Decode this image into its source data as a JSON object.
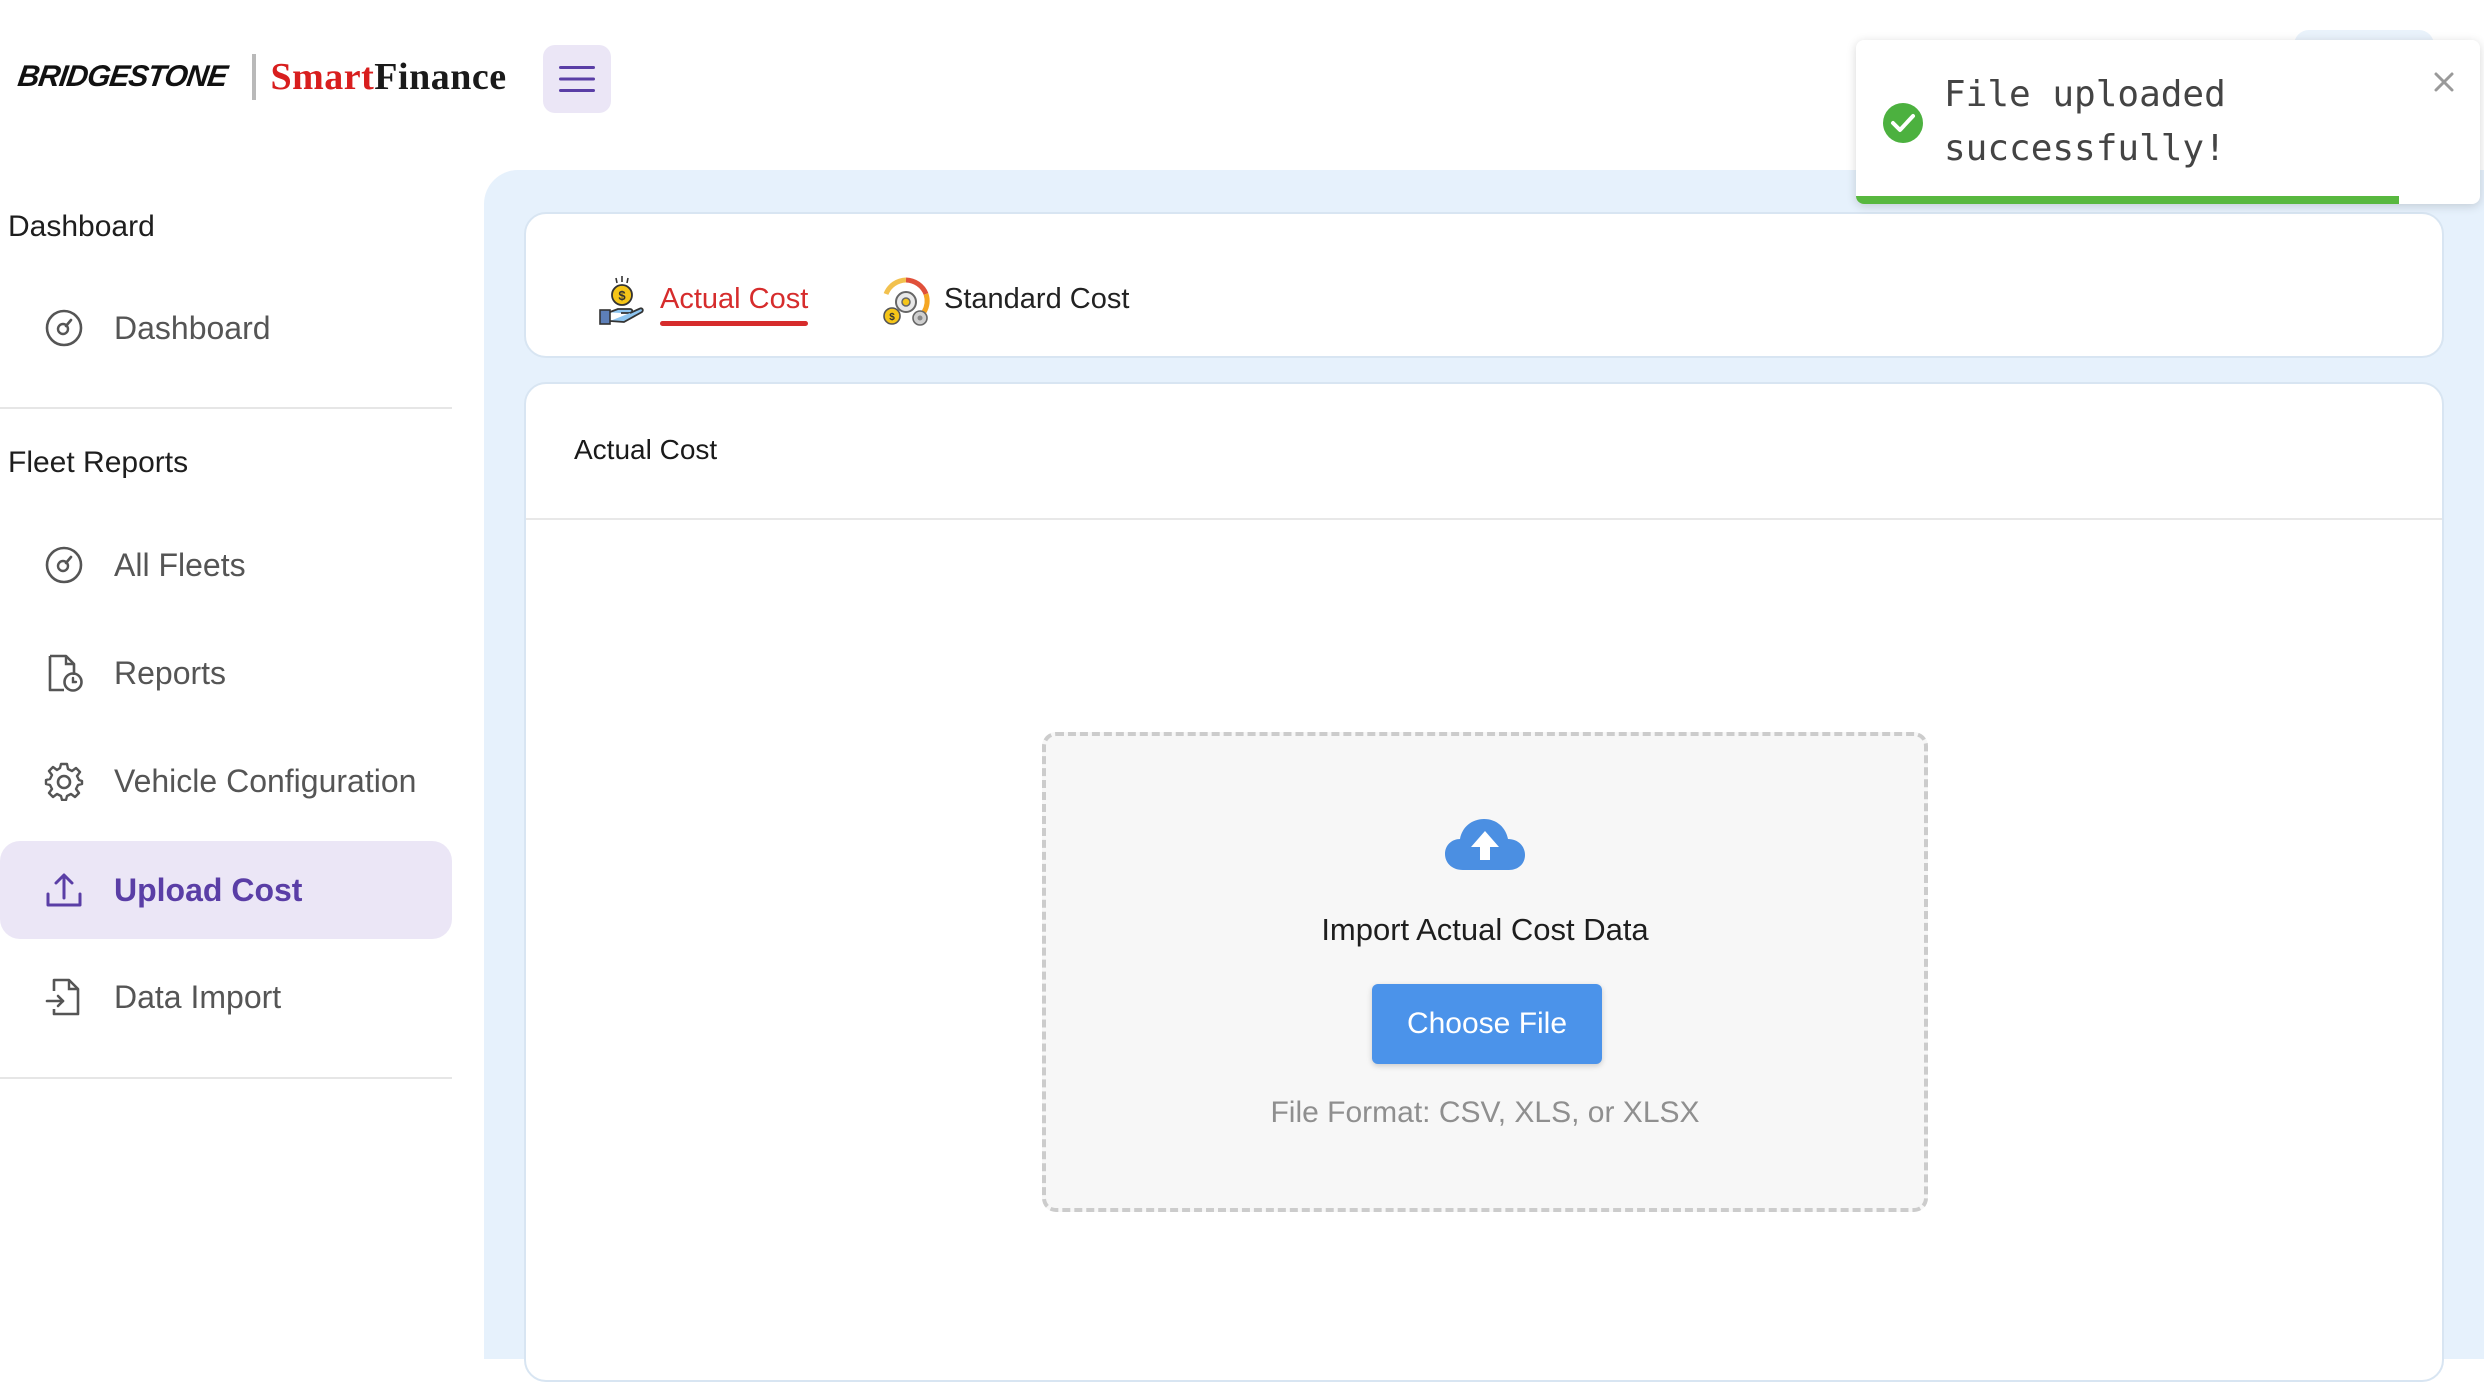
{
  "header": {
    "brand_main": "BRIDGESTONE",
    "brand_smart": "Smart",
    "brand_finance": "Finance",
    "menu_icon": "hamburger-icon"
  },
  "sidebar": {
    "sections": [
      {
        "title": "Dashboard",
        "items": [
          {
            "label": "Dashboard",
            "icon": "gauge-icon",
            "active": false
          }
        ]
      },
      {
        "title": "Fleet Reports",
        "items": [
          {
            "label": "All Fleets",
            "icon": "gauge-icon",
            "active": false
          },
          {
            "label": "Reports",
            "icon": "report-clock-icon",
            "active": false
          },
          {
            "label": "Vehicle Configuration",
            "icon": "gear-icon",
            "active": false
          },
          {
            "label": "Upload Cost",
            "icon": "upload-icon",
            "active": true
          },
          {
            "label": "Data Import",
            "icon": "file-import-icon",
            "active": false
          }
        ]
      }
    ]
  },
  "tabs": [
    {
      "label": "Actual Cost",
      "icon": "money-hand-icon",
      "active": true
    },
    {
      "label": "Standard Cost",
      "icon": "cost-gear-icon",
      "active": false
    }
  ],
  "card": {
    "title": "Actual Cost"
  },
  "upload": {
    "icon": "cloud-upload-icon",
    "title": "Import Actual Cost Data",
    "button_label": "Choose File",
    "format_note": "File Format: CSV, XLS, or XLSX"
  },
  "toast": {
    "message": "File uploaded successfully!",
    "icon": "check-circle-icon",
    "close_icon": "close-icon",
    "progress": 0.87
  },
  "colors": {
    "accent_purple": "#5a3ea6",
    "active_bg": "#ebe6f6",
    "tab_active": "#d62c2c",
    "button_blue": "#4b93ea",
    "success_green": "#58b83f",
    "main_bg": "#e6f1fc"
  }
}
